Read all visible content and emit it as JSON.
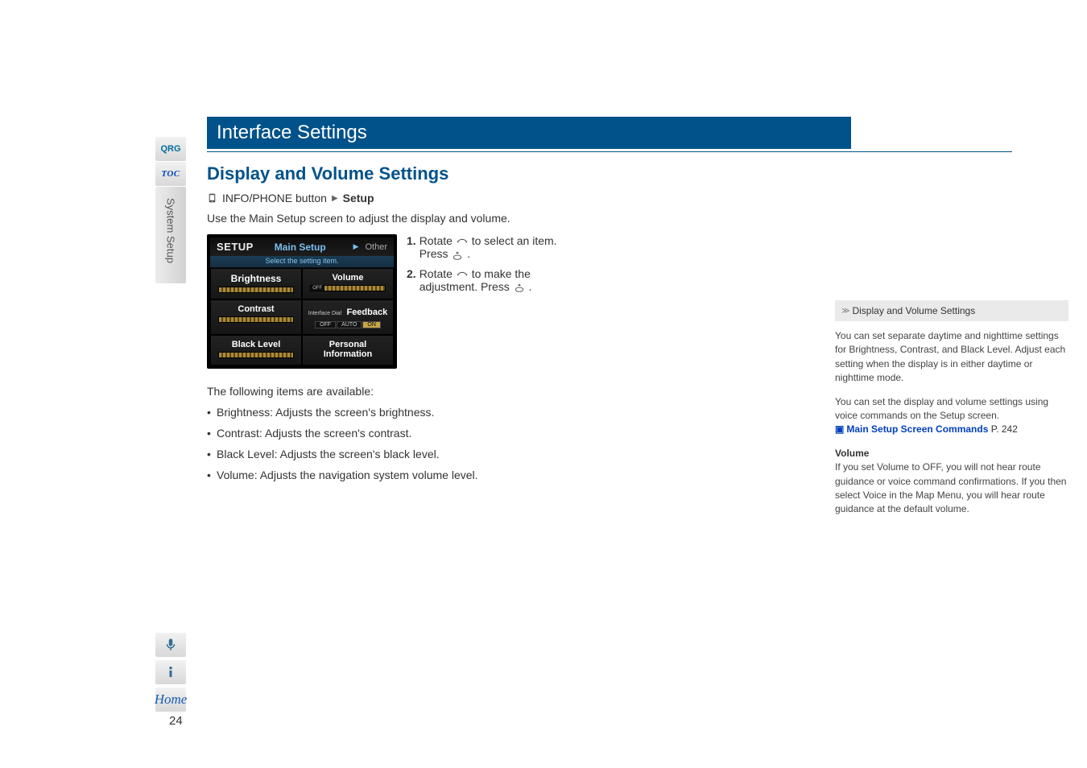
{
  "nav": {
    "qrg": "QRG",
    "toc": "TOC",
    "vertical": "System Setup",
    "page_number": "24",
    "home": "Home"
  },
  "title": "Interface Settings",
  "section": "Display and Volume Settings",
  "breadcrumb": {
    "button_label": "INFO/PHONE button",
    "dest": "Setup"
  },
  "intro": "Use the Main Setup screen to adjust the display and volume.",
  "device": {
    "setup": "SETUP",
    "main_setup": "Main Setup",
    "other": "Other",
    "sub": "Select the setting item.",
    "cells": {
      "brightness": "Brightness",
      "volume": "Volume",
      "off": "OFF",
      "contrast": "Contrast",
      "interface_dial": "Interface Dial",
      "feedback": "Feedback",
      "seg_off": "OFF",
      "seg_auto": "AUTO",
      "seg_on": "ON",
      "black_level": "Black Level",
      "personal": "Personal",
      "information": "Information"
    }
  },
  "steps": {
    "s1_pre": "Rotate ",
    "s1_post": " to select an item. Press ",
    "s1_end": ".",
    "s2_pre": "Rotate ",
    "s2_post": " to make the adjustment. Press ",
    "s2_end": "."
  },
  "items_intro": "The following items are available:",
  "items": [
    {
      "label": "Brightness:",
      "desc": "Adjusts the screen's brightness."
    },
    {
      "label": "Contrast:",
      "desc": "Adjusts the screen's contrast."
    },
    {
      "label": "Black Level:",
      "desc": "Adjusts the screen's black level."
    },
    {
      "label": "Volume:",
      "desc": "Adjusts the navigation system volume level."
    }
  ],
  "tips": {
    "header": "Display and Volume Settings",
    "p1_a": "You can set separate daytime and nighttime settings for ",
    "p1_brightness": "Brightness",
    "p1_comma1": ", ",
    "p1_contrast": "Contrast",
    "p1_comma2": ", and ",
    "p1_black": "Black Level",
    "p1_b": ". Adjust each setting when the display is in either daytime or nighttime mode.",
    "p2": "You can set the display and volume settings using voice commands on the Setup screen.",
    "link_text": "Main Setup Screen Commands",
    "link_page": "P. 242",
    "vol_heading": "Volume",
    "p3_a": "If you set ",
    "p3_volume": "Volume",
    "p3_b": " to ",
    "p3_off": "OFF",
    "p3_c": ", you will not hear route guidance or voice command confirmations. If you then select ",
    "p3_voice": "Voice",
    "p3_d": " in the Map Menu, you will hear route guidance at the default volume."
  }
}
